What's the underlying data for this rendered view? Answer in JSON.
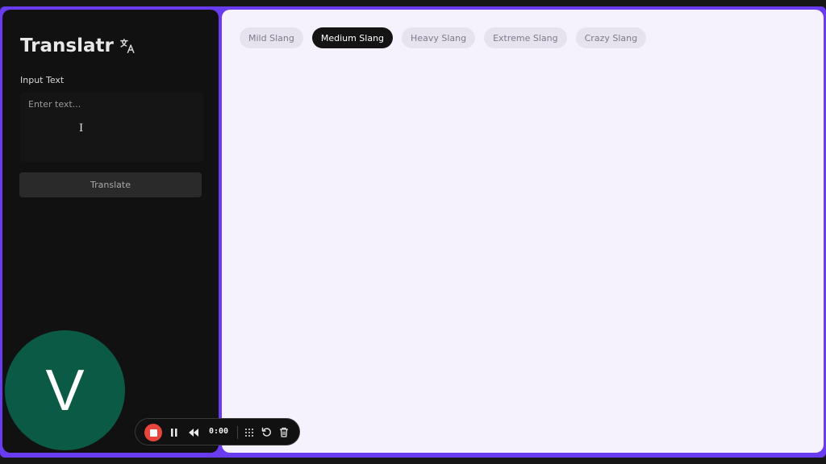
{
  "app": {
    "title": "Translatr",
    "brand_icon": "translate-icon"
  },
  "input": {
    "label": "Input Text",
    "placeholder": "Enter text...",
    "value": ""
  },
  "translate_button": {
    "label": "Translate"
  },
  "tabs": [
    {
      "label": "Mild Slang",
      "active": false
    },
    {
      "label": "Medium Slang",
      "active": true
    },
    {
      "label": "Heavy Slang",
      "active": false
    },
    {
      "label": "Extreme Slang",
      "active": false
    },
    {
      "label": "Crazy Slang",
      "active": false
    }
  ],
  "avatar": {
    "initial": "V",
    "color": "#0b5a45"
  },
  "recorder": {
    "time": "0:00",
    "icons": [
      "stop-icon",
      "pause-icon",
      "rewind-icon",
      "grid-icon",
      "restart-icon",
      "trash-icon"
    ]
  },
  "colors": {
    "accent_frame": "#6a3cf0",
    "sidebar_bg": "#111111",
    "main_bg": "#f6f2fd",
    "active_tab_bg": "#141414",
    "record_red": "#e8463c"
  }
}
